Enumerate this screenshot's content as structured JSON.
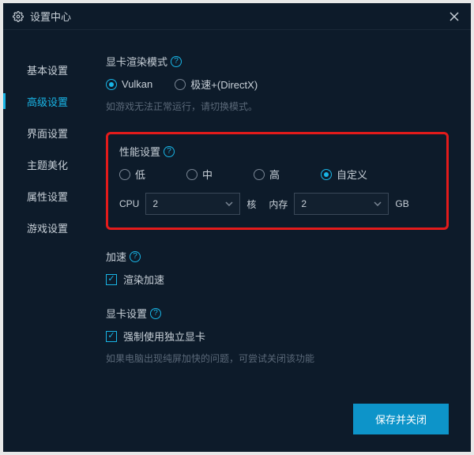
{
  "title": "设置中心",
  "sidebar": {
    "items": [
      {
        "label": "基本设置"
      },
      {
        "label": "高级设置"
      },
      {
        "label": "界面设置"
      },
      {
        "label": "主题美化"
      },
      {
        "label": "属性设置"
      },
      {
        "label": "游戏设置"
      }
    ],
    "active_index": 1
  },
  "render_mode": {
    "title": "显卡渲染模式",
    "options": [
      {
        "label": "Vulkan",
        "checked": true
      },
      {
        "label": "极速+(DirectX)",
        "checked": false
      }
    ],
    "hint": "如游戏无法正常运行，请切换模式。"
  },
  "performance": {
    "title": "性能设置",
    "options": [
      {
        "label": "低",
        "checked": false
      },
      {
        "label": "中",
        "checked": false
      },
      {
        "label": "高",
        "checked": false
      },
      {
        "label": "自定义",
        "checked": true
      }
    ],
    "cpu_label": "CPU",
    "cpu_value": "2",
    "cpu_unit": "核",
    "mem_label": "内存",
    "mem_value": "2",
    "mem_unit": "GB"
  },
  "accel": {
    "title": "加速",
    "checkbox_label": "渲染加速",
    "checked": true
  },
  "gpu": {
    "title": "显卡设置",
    "checkbox_label": "强制使用独立显卡",
    "checked": true,
    "hint": "如果电脑出现纯屏加快的问题，可尝试关闭该功能"
  },
  "footer": {
    "save_label": "保存并关闭"
  }
}
